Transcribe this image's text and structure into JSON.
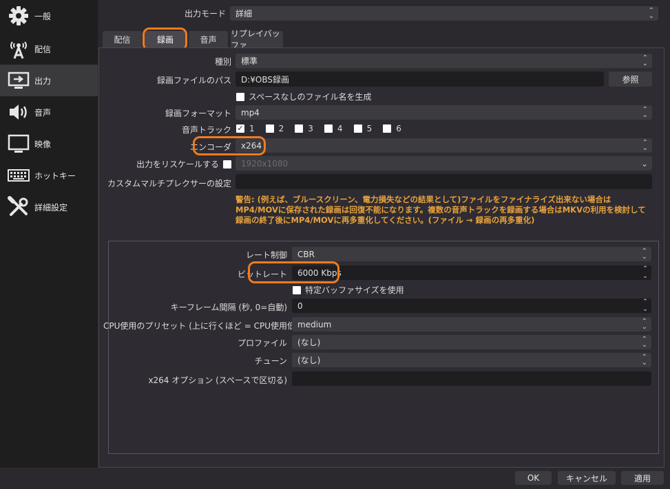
{
  "sidebar": {
    "items": [
      {
        "label": "一般",
        "icon": "gear-icon"
      },
      {
        "label": "配信",
        "icon": "broadcast-antenna-icon"
      },
      {
        "label": "出力",
        "icon": "output-monitor-icon"
      },
      {
        "label": "音声",
        "icon": "speaker-icon"
      },
      {
        "label": "映像",
        "icon": "monitor-icon"
      },
      {
        "label": "ホットキー",
        "icon": "keyboard-icon"
      },
      {
        "label": "詳細設定",
        "icon": "tools-icon"
      }
    ],
    "active_index": 2
  },
  "output_mode": {
    "label": "出力モード",
    "value": "詳細"
  },
  "tabs": [
    {
      "label": "配信"
    },
    {
      "label": "録画"
    },
    {
      "label": "音声"
    },
    {
      "label": "リプレイバッファ"
    }
  ],
  "recording": {
    "type_label": "種別",
    "type_value": "標準",
    "path_label": "録画ファイルのパス",
    "path_value": "D:¥OBS録画",
    "browse_label": "参照",
    "nospace_label": "スペースなしのファイル名を生成",
    "format_label": "録画フォーマット",
    "format_value": "mp4",
    "tracks_label": "音声トラック",
    "tracks": [
      "1",
      "2",
      "3",
      "4",
      "5",
      "6"
    ],
    "encoder_label": "エンコーダ",
    "encoder_value": "x264",
    "rescale_label": "出力をリスケールする",
    "rescale_value": "1920x1080",
    "muxer_label": "カスタムマルチプレクサーの設定",
    "warning": "警告: (例えば、ブルースクリーン、電力損失などの結果として)ファイルをファイナライズ出来ない場合はMP4/MOVに保存された録画は回復不能になります。複数の音声トラックを録画する場合はMKVの利用を検討して録画の終了後にMP4/MOVに再多重化してください。(ファイル → 録画の再多重化)"
  },
  "encoder_settings": {
    "rate_control_label": "レート制御",
    "rate_control_value": "CBR",
    "bitrate_label": "ビットレート",
    "bitrate_value": "6000 Kbps",
    "custom_buffer_label": "特定バッファサイズを使用",
    "keyframe_label": "キーフレーム間隔 (秒, 0=自動)",
    "keyframe_value": "0",
    "preset_label": "CPU使用のプリセット (上に行くほど = CPU使用低い)",
    "preset_value": "medium",
    "profile_label": "プロファイル",
    "profile_value": "(なし)",
    "tune_label": "チューン",
    "tune_value": "(なし)",
    "options_label": "x264 オプション (スペースで区切る)"
  },
  "footer": {
    "ok": "OK",
    "cancel": "キャンセル",
    "apply": "適用"
  },
  "colors": {
    "highlight": "#f07b1d",
    "warning": "#e8a23c",
    "background": "#2b292e",
    "sidebar": "#1e1e1e"
  }
}
